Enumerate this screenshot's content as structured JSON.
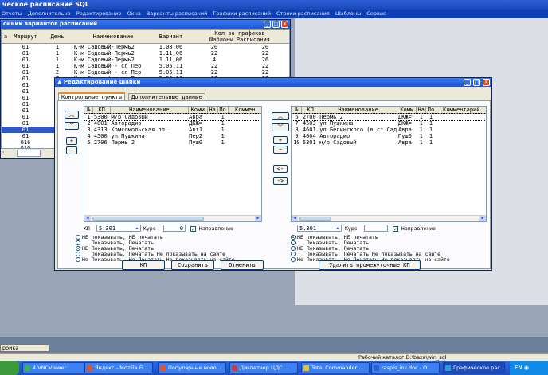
{
  "app": {
    "title": "ческое расписание SQL"
  },
  "menu": [
    "Отчеты",
    "Дополнительно",
    "Редактирование",
    "Окна",
    "Варианты расписаний",
    "Графики расписаний",
    "Строки расписания",
    "Шаблоны",
    "Сервис"
  ],
  "variants_window": {
    "title": "онник вариантов расписаний",
    "headers": [
      "а",
      "Маршрут",
      "День",
      "Наименование",
      "Вариант",
      "Кол-во графиков",
      "Шаблоны",
      "Расписания"
    ],
    "rows": [
      [
        "",
        "01",
        "1",
        "К-м Садовый-Пермь2",
        "1.08.06",
        "20",
        "20"
      ],
      [
        "",
        "01",
        "1",
        "К-м Садовый-Пермь2",
        "1.11.06",
        "22",
        "22"
      ],
      [
        "",
        "01",
        "1",
        "К-м Садовый-Пермь2",
        "1.11.06",
        "4",
        "26"
      ],
      [
        "",
        "01",
        "1",
        "К-м Садовый - сл Пер",
        "5.05.11",
        "22",
        "22"
      ],
      [
        "",
        "01",
        "2",
        "К-м Садовый - сл Пер",
        "5.05.11",
        "22",
        "22"
      ],
      [
        "",
        "01",
        "7",
        "К-м Садовый - сл Пер",
        "5.05.11",
        "22",
        "22"
      ],
      [
        "",
        "01",
        "",
        "",
        "",
        "",
        ""
      ],
      [
        "",
        "01",
        "",
        "",
        "",
        "",
        ""
      ],
      [
        "",
        "01",
        "",
        "",
        "",
        "",
        ""
      ],
      [
        "",
        "01",
        "",
        "",
        "",
        "",
        ""
      ],
      [
        "",
        "01",
        "",
        "",
        "",
        "",
        ""
      ],
      [
        "",
        "01",
        "",
        "",
        "",
        "",
        ""
      ],
      [
        "",
        "01",
        "",
        "",
        "",
        "",
        ""
      ],
      [
        "",
        "01",
        "",
        "",
        "",
        "",
        ""
      ],
      [
        "",
        "01",
        "",
        "",
        "",
        "",
        ""
      ],
      [
        "",
        "016",
        "",
        "",
        "",
        "",
        ""
      ],
      [
        "",
        "019",
        "",
        "",
        "",
        "",
        ""
      ],
      [
        "",
        "019",
        "",
        "",
        "",
        "",
        ""
      ]
    ],
    "filter_label": ":"
  },
  "editor": {
    "title": "Редактирование шапки",
    "tabs": [
      "Контрольные пункты",
      "Дополнительные данные"
    ],
    "left_headers": [
      "№",
      "КП",
      "Наименование",
      "Комм",
      "На",
      "По",
      "Коммен"
    ],
    "left_rows": [
      [
        "1",
        "5300",
        "м/р Садовый",
        "Авра",
        "",
        "1",
        ""
      ],
      [
        "2",
        "4001",
        "Авторадио",
        "ДКЖ=",
        "",
        "1",
        ""
      ],
      [
        "3",
        "4313",
        "Комсомольская пл.",
        "Авт1",
        "",
        "1",
        ""
      ],
      [
        "4",
        "4500",
        "ул Пушкина",
        "Пер2",
        "",
        "1",
        ""
      ],
      [
        "5",
        "2706",
        "Пермь 2",
        "Пуш0",
        "",
        "1",
        ""
      ]
    ],
    "right_headers": [
      "№",
      "КП",
      "Наименование",
      "Комм",
      "На",
      "По",
      "Комментарий"
    ],
    "right_rows": [
      [
        "6",
        "2700",
        "Пермь 2",
        "ДКЖ=",
        "1",
        "1",
        ""
      ],
      [
        "7",
        "4503",
        "ул Пушкина",
        "ДКЖ=",
        "1",
        "1",
        ""
      ],
      [
        "8",
        "4601",
        "ул.Белинского (в ст.Садов.)",
        "Авра",
        "1",
        "1",
        ""
      ],
      [
        "9",
        "4004",
        "Авторадио",
        "Пуш0",
        "1",
        "1",
        ""
      ],
      [
        "10",
        "5301",
        "м/р Садовый",
        "Авра",
        "1",
        "1",
        ""
      ]
    ],
    "kp_label": "КП",
    "kurs_label": "Курс",
    "left_kp_value": "5.301",
    "left_kurs_value": "0",
    "right_kp_value": "5.301",
    "right_kurs_value": "",
    "direction_label": "Направление",
    "left_radios": [
      "НЕ показывать, НЕ печатать",
      "Показывать, Печатать",
      "НЕ Показывать, Печатать",
      "Показывать, Печатать Не показывать на сайте",
      "Не Показывать, Не Печатать Не показывать на сайте"
    ],
    "right_radios": [
      "НЕ показывать, НЕ печатать",
      "Показывать, Печатать",
      "НЕ Показывать, Печатать",
      "Показывать, Печатать Не показывать на сайте",
      "Не Показывать, Не Печатать Не показывать на сайте"
    ],
    "btn_kp": "КП",
    "btn_save": "Сохранить",
    "btn_cancel": "Отменить",
    "btn_remove": "Удалить промежуточные КП"
  },
  "status_tab": "ройка маршрута",
  "status_catalog": "Рабочий каталог:D:\\baza\\win_sql",
  "taskbar": [
    {
      "label": "4 VNCViewer",
      "color": "#38b44a"
    },
    {
      "label": "Яндекс - Mozilla Fi...",
      "color": "#e0542a"
    },
    {
      "label": "Популярные ново...",
      "color": "#e0542a"
    },
    {
      "label": "Диспетчер ЦДС ...",
      "color": "#d03a3a"
    },
    {
      "label": "Total Commander ...",
      "color": "#f0c020"
    },
    {
      "label": "raspis_ins.doc - O...",
      "color": "#2f5fd0"
    },
    {
      "label": "Графическое рас...",
      "color": "#2aa0d0"
    }
  ],
  "tray_lang": "EN"
}
